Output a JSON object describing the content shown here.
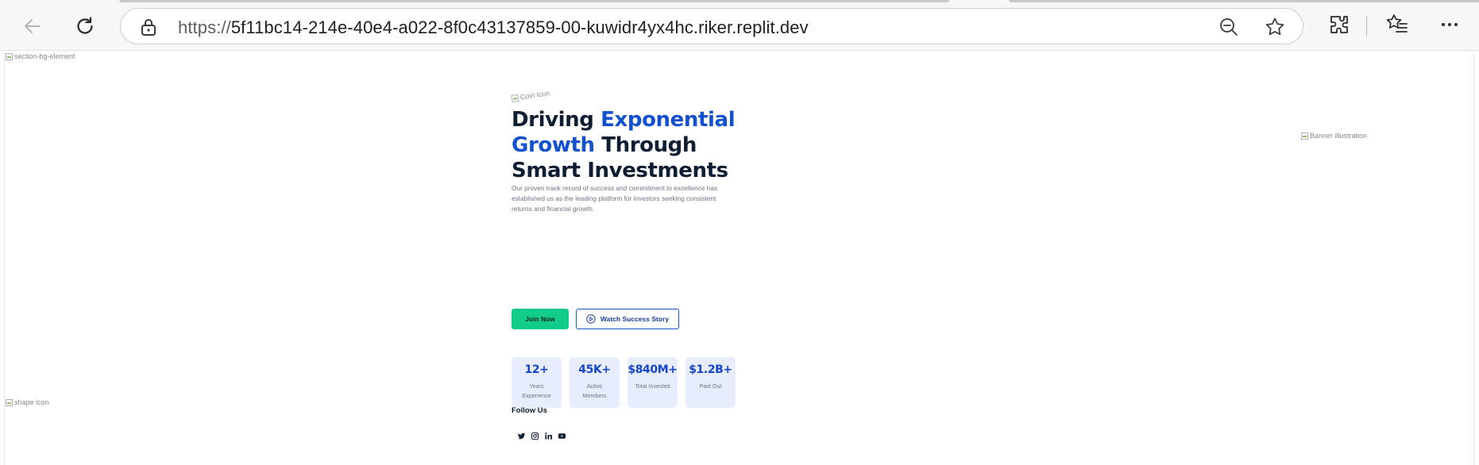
{
  "browser": {
    "url_scheme": "https://",
    "url_host": "5f11bc14-214e-40e4-a022-8f0c43137859-00-kuwidr4yx4hc.riker.replit.dev",
    "icons": [
      "back-arrow-icon",
      "refresh-icon",
      "lock-icon",
      "zoom-out-icon",
      "star-icon",
      "extensions-icon",
      "favorites-icon",
      "more-icon"
    ]
  },
  "page": {
    "bg_alt": "section-bg-element",
    "shape_alt": "shape icon",
    "banner_alt": "Banner illustration",
    "coin_alt": "Coin icon"
  },
  "hero": {
    "title_part1": "Driving ",
    "title_accent": "Exponential Growth",
    "title_part2": " Through Smart Investments",
    "description": "Our proven track record of success and commitment to excellence has established us as the leading platform for investors seeking consistent returns and financial growth.",
    "join_label": "Join Now",
    "watch_label": "Watch Success Story"
  },
  "stats": [
    {
      "value": "12+",
      "label": "Years Experience"
    },
    {
      "value": "45K+",
      "label": "Active Members"
    },
    {
      "value": "$840M+",
      "label": "Total Invested"
    },
    {
      "value": "$1.2B+",
      "label": "Paid Out"
    }
  ],
  "social": {
    "heading": "Follow Us",
    "icons": [
      "twitter-icon",
      "instagram-icon",
      "linkedin-icon",
      "youtube-icon"
    ]
  },
  "colors": {
    "accent_blue": "#1451d1",
    "join_green": "#12cc8a",
    "stat_bg": "#e8edfd",
    "heading_dark": "#0f1d33"
  }
}
